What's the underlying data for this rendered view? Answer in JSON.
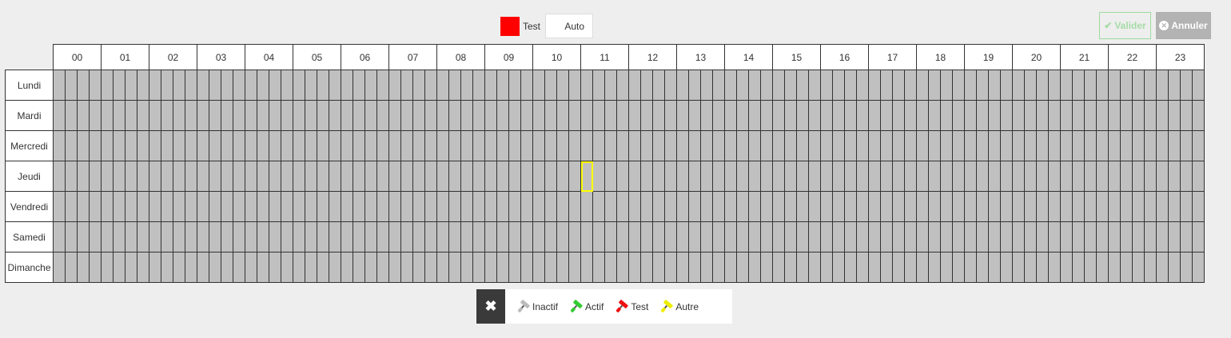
{
  "mode": {
    "label": "Test",
    "color": "#ff0000",
    "select_value": "Auto"
  },
  "buttons": {
    "validate_label": "Valider",
    "cancel_label": "Annuler"
  },
  "schedule": {
    "hours": [
      "00",
      "01",
      "02",
      "03",
      "04",
      "05",
      "06",
      "07",
      "08",
      "09",
      "10",
      "11",
      "12",
      "13",
      "14",
      "15",
      "16",
      "17",
      "18",
      "19",
      "20",
      "21",
      "22",
      "23"
    ],
    "days": [
      "Lundi",
      "Mardi",
      "Mercredi",
      "Jeudi",
      "Vendredi",
      "Samedi",
      "Dimanche"
    ],
    "slots_per_hour": 4,
    "slot_color": "#c0c0c0",
    "selected_slot": {
      "day": "Jeudi",
      "hour": "11",
      "quarter": 0
    }
  },
  "toolbar": {
    "clear_symbol": "✖",
    "brushes": [
      {
        "label": "Inactif",
        "color": "#bbbbbb",
        "icon": "paint-roller-icon"
      },
      {
        "label": "Actif",
        "color": "#33cc33",
        "icon": "paint-roller-icon"
      },
      {
        "label": "Test",
        "color": "#ee1111",
        "icon": "paint-roller-icon"
      },
      {
        "label": "Autre",
        "color": "#eeee00",
        "icon": "paint-roller-icon"
      }
    ]
  }
}
